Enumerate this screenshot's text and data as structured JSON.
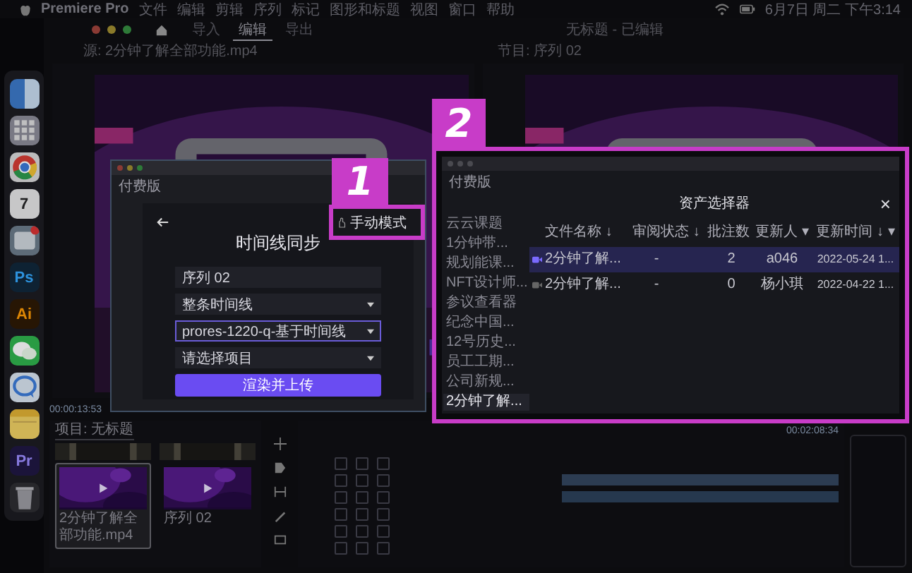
{
  "menubar": {
    "app_name": "Premiere Pro",
    "menus": [
      "文件",
      "编辑",
      "剪辑",
      "序列",
      "标记",
      "图形和标题",
      "视图",
      "窗口",
      "帮助"
    ],
    "clock": "6月7日 周二 下午3:14"
  },
  "app_window": {
    "tabs": [
      {
        "label": "导入",
        "selected": false
      },
      {
        "label": "编辑",
        "selected": true
      },
      {
        "label": "导出",
        "selected": false
      }
    ],
    "title": "无标题 - 已编辑"
  },
  "dock": [
    {
      "kind": "finder"
    },
    {
      "kind": "launchpad"
    },
    {
      "kind": "chrome"
    },
    {
      "kind": "calendar",
      "label": "7"
    },
    {
      "kind": "reminders"
    },
    {
      "kind": "ps",
      "label": "Ps"
    },
    {
      "kind": "ai",
      "label": "Ai"
    },
    {
      "kind": "wechat"
    },
    {
      "kind": "chat"
    },
    {
      "kind": "notes"
    },
    {
      "kind": "pr",
      "label": "Pr"
    },
    {
      "kind": "trash"
    }
  ],
  "source_monitor": {
    "title": "源: 2分钟了解全部功能.mp4",
    "timecode": "00:00:13:53"
  },
  "program_monitor": {
    "title": "节目: 序列 02",
    "timecode": "00:02:08:34"
  },
  "project_panel": {
    "tab": "项目: 无标题",
    "items": [
      {
        "name": "2分钟了解全部功能.mp4",
        "selected": true
      },
      {
        "name": "序列 02",
        "selected": false
      }
    ]
  },
  "callouts": [
    {
      "label": "1"
    },
    {
      "label": "2"
    }
  ],
  "sync_dialog": {
    "app_label": "付费版",
    "title": "时间线同步",
    "mode_label": "手动模式",
    "fields": [
      {
        "kind": "input",
        "value": "序列 02",
        "focused": false
      },
      {
        "kind": "select",
        "value": "整条时间线",
        "focused": false
      },
      {
        "kind": "select",
        "value": "prores-1220-q-基于时间线",
        "focused": true
      },
      {
        "kind": "select",
        "value": "请选择项目",
        "focused": false
      }
    ],
    "button": "渲染并上传"
  },
  "asset_dialog": {
    "app_label": "付费版",
    "title": "资产选择器",
    "close": "×",
    "folders": [
      {
        "name": "云云课题",
        "selected": false
      },
      {
        "name": "1分钟带...",
        "selected": false
      },
      {
        "name": "规划能课...",
        "selected": false
      },
      {
        "name": "NFT设计师...",
        "selected": false
      },
      {
        "name": "参议查看器",
        "selected": false
      },
      {
        "name": "纪念中国...",
        "selected": false
      },
      {
        "name": "12号历史...",
        "selected": false
      },
      {
        "name": "员工工期...",
        "selected": false
      },
      {
        "name": "公司新规...",
        "selected": false
      },
      {
        "name": "2分钟了解...",
        "selected": true
      }
    ],
    "columns": [
      "文件名称 ↓",
      "审阅状态 ↓",
      "批注数",
      "更新人 ▾",
      "更新时间 ↓ ▾"
    ],
    "rows": [
      {
        "selected": true,
        "cells": [
          "2分钟了解...",
          "-",
          "2",
          "a046",
          "2022-05-24 1..."
        ]
      },
      {
        "selected": false,
        "cells": [
          "2分钟了解...",
          "-",
          "0",
          "杨小琪",
          "2022-04-22 1..."
        ]
      }
    ]
  }
}
